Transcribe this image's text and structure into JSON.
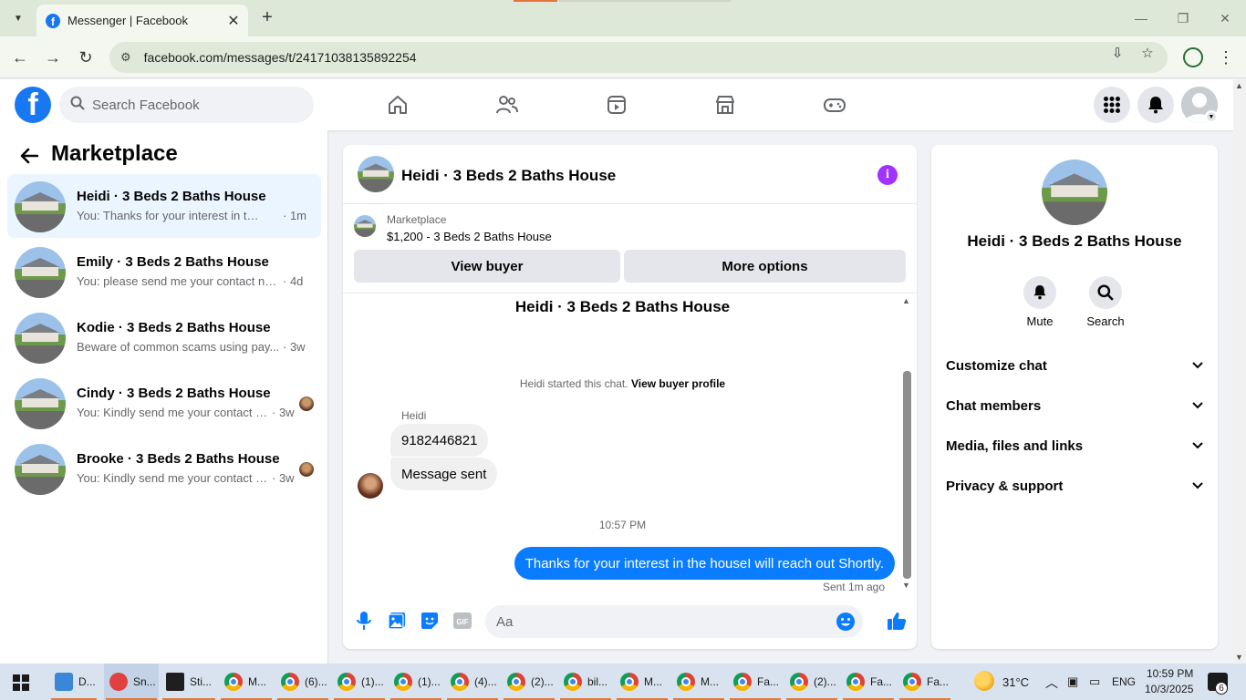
{
  "browser": {
    "tab_title": "Messenger | Facebook",
    "url": "facebook.com/messages/t/24171038135892254",
    "new_tab": "+",
    "close_tab": "✕"
  },
  "fb": {
    "search_placeholder": "Search Facebook",
    "accent": "#1877f2"
  },
  "sidebar": {
    "title": "Marketplace",
    "conversations": [
      {
        "name": "Heidi · 3 Beds 2 Baths House",
        "preview": "You: Thanks for your interest in the h...",
        "time": "· 1m",
        "active": true
      },
      {
        "name": "Emily · 3 Beds 2 Baths House",
        "preview": "You: please send me your contact nu...",
        "time": "· 4d"
      },
      {
        "name": "Kodie · 3 Beds 2 Baths House",
        "preview": "Beware of common scams using pay...",
        "time": "· 3w"
      },
      {
        "name": "Cindy · 3 Beds 2 Baths House",
        "preview": "You: Kindly send me your contact n...",
        "time": "· 3w"
      },
      {
        "name": "Brooke · 3 Beds 2 Baths House",
        "preview": "You: Kindly send me your contact n...",
        "time": "· 3w"
      }
    ]
  },
  "chat": {
    "header_title": "Heidi · 3 Beds 2 Baths House",
    "marketplace_label": "Marketplace",
    "listing": "$1,200 - 3 Beds 2 Baths House",
    "view_buyer": "View buyer",
    "more_options": "More options",
    "thread_title": "Heidi · 3 Beds 2 Baths House",
    "started_text": "Heidi started this chat.",
    "view_buyer_profile": "View buyer profile",
    "sender_name": "Heidi",
    "incoming": [
      "9182446821",
      "Message sent"
    ],
    "time_separator": "10:57 PM",
    "outgoing": "Thanks for your interest in the houseI will reach out Shortly.",
    "sent_status": "Sent 1m ago",
    "composer_placeholder": "Aa",
    "outgoing_color": "#0a7cff"
  },
  "info_panel": {
    "name": "Heidi · 3 Beds 2 Baths House",
    "mute": "Mute",
    "search": "Search",
    "sections": [
      "Customize chat",
      "Chat members",
      "Media, files and links",
      "Privacy & support"
    ]
  },
  "taskbar": {
    "items": [
      "D...",
      "Sn...",
      "Sti...",
      "M...",
      "(6)...",
      "(1)...",
      "(1)...",
      "(4)...",
      "(2)...",
      "bil...",
      "M...",
      "M...",
      "Fa...",
      "(2)...",
      "Fa...",
      "Fa..."
    ],
    "temperature": "31°C",
    "language": "ENG",
    "time": "10:59 PM",
    "date": "10/3/2025",
    "notifications": "6"
  }
}
